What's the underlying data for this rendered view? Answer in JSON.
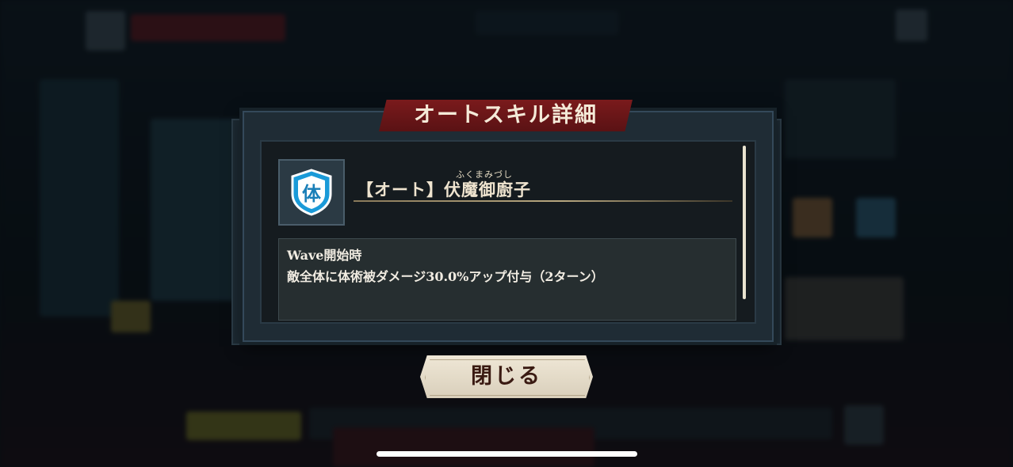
{
  "dialog": {
    "title": "オートスキル詳細",
    "skill": {
      "icon_name": "shield-icon",
      "icon_glyph": "体",
      "name_ruby": "ふくまみづし",
      "name": "【オート】伏魔御廚子"
    },
    "description": {
      "trigger": "Wave開始時",
      "effect": "敵全体に体術被ダメージ30.0%アップ付与（2ターン）"
    },
    "close_button_label": "閉じる"
  },
  "colors": {
    "banner": "#7a1a1c",
    "panel": "#1f2c35",
    "text": "#f1ece2",
    "icon_blue": "#1a9ad8"
  }
}
